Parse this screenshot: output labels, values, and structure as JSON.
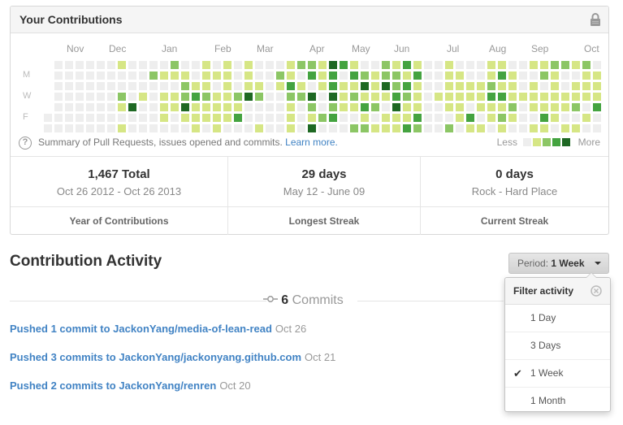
{
  "contributions": {
    "title": "Your Contributions",
    "months": [
      {
        "label": "Nov",
        "col": 2
      },
      {
        "label": "Dec",
        "col": 6
      },
      {
        "label": "Jan",
        "col": 11
      },
      {
        "label": "Feb",
        "col": 16
      },
      {
        "label": "Mar",
        "col": 20
      },
      {
        "label": "Apr",
        "col": 25
      },
      {
        "label": "May",
        "col": 29
      },
      {
        "label": "Jun",
        "col": 33
      },
      {
        "label": "Jul",
        "col": 38
      },
      {
        "label": "Aug",
        "col": 42
      },
      {
        "label": "Sep",
        "col": 46
      },
      {
        "label": "Oct",
        "col": 51
      }
    ],
    "day_labels": [
      {
        "label": "M",
        "row": 1
      },
      {
        "label": "W",
        "row": 3
      },
      {
        "label": "F",
        "row": 5
      }
    ],
    "summary_text": "Summary of Pull Requests, issues opened and commits.",
    "learn_more": "Learn more.",
    "legend_less": "Less",
    "legend_more": "More",
    "colors": [
      "#eeeeee",
      "#d6e685",
      "#8cc665",
      "#44a340",
      "#1e6823"
    ]
  },
  "stats": [
    {
      "value": "1,467 Total",
      "range": "Oct 26 2012 - Oct 26 2013",
      "label": "Year of Contributions"
    },
    {
      "value": "29 days",
      "range": "May 12 - June 09",
      "label": "Longest Streak"
    },
    {
      "value": "0 days",
      "range": "Rock - Hard Place",
      "label": "Current Streak"
    }
  ],
  "activity": {
    "title": "Contribution Activity",
    "period_label": "Period:",
    "period_value": "1 Week",
    "commits_count": "6",
    "commits_label": "Commits",
    "commits": [
      {
        "text": "Pushed 1 commit to JackonYang/media-of-lean-read",
        "date": "Oct 26"
      },
      {
        "text": "Pushed 3 commits to JackonYang/jackonyang.github.com",
        "date": "Oct 21"
      },
      {
        "text": "Pushed 2 commits to JackonYang/renren",
        "date": "Oct 20"
      }
    ]
  },
  "filter": {
    "title": "Filter activity",
    "options": [
      {
        "label": "1 Day",
        "selected": false
      },
      {
        "label": "3 Days",
        "selected": false
      },
      {
        "label": "1 Week",
        "selected": true
      },
      {
        "label": "1 Month",
        "selected": false
      }
    ]
  }
}
